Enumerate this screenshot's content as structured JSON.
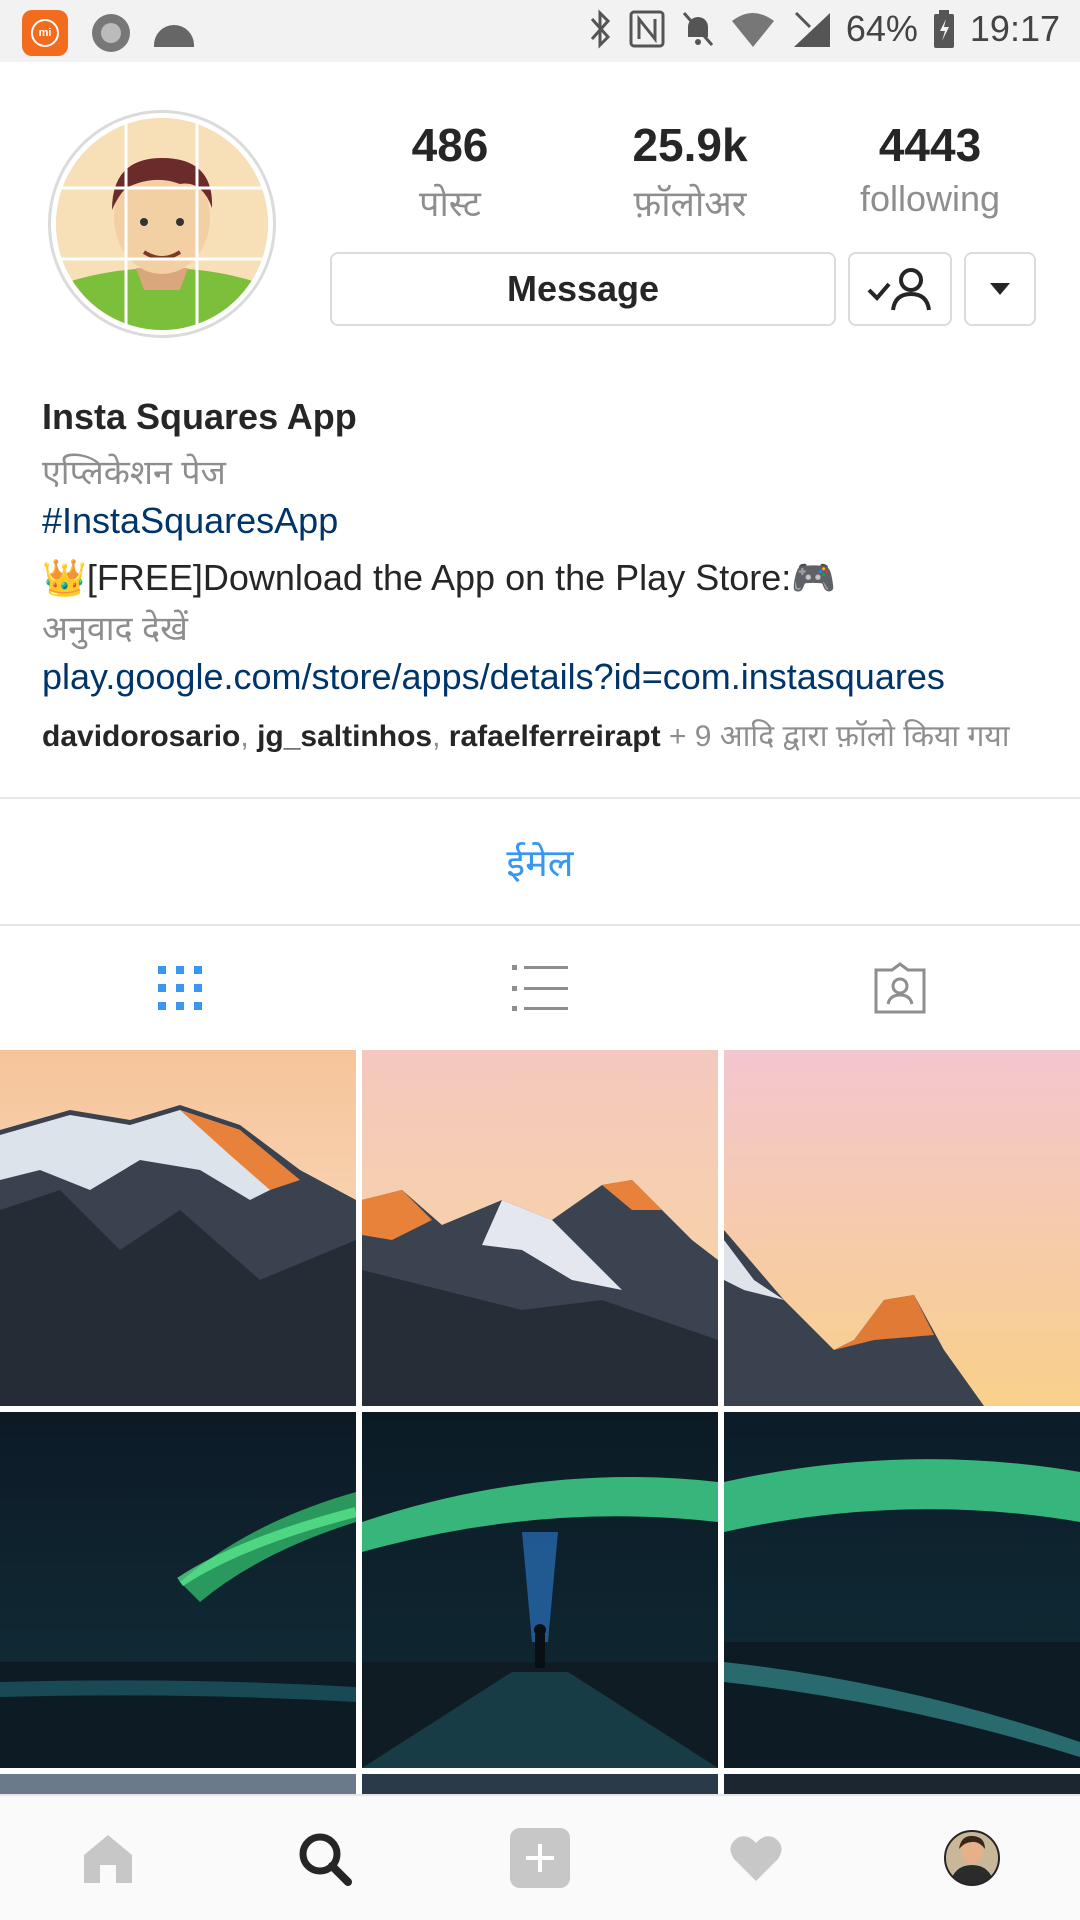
{
  "status_bar": {
    "battery": "64%",
    "time": "19:17"
  },
  "profile": {
    "posts_count": "486",
    "posts_label": "पोस्ट",
    "followers_count": "25.9k",
    "followers_label": "फ़ॉलोअर",
    "following_count": "4443",
    "following_label": "following",
    "message_label": "Message"
  },
  "bio": {
    "name": "Insta Squares App",
    "category": "एप्लिकेशन पेज",
    "hashtag": "#InstaSquaresApp",
    "crown_emoji": "👑",
    "description": "[FREE]Download the App on the Play Store: ",
    "controller_emoji": "🎮",
    "translate": "अनुवाद देखें",
    "link": "play.google.com/store/apps/details?id=com.instasquares",
    "followed_user_1": "davidorosario",
    "followed_user_2": "jg_saltinhos",
    "followed_user_3": "rafaelferreirapt",
    "followed_suffix": " + 9 आदि द्वारा फ़ॉलो किया गया"
  },
  "email_label": "ईमेल",
  "tabs": {
    "icons": [
      "grid-icon",
      "list-icon",
      "tagged-icon"
    ],
    "active": "grid"
  },
  "nav": {
    "icons": [
      "home-icon",
      "search-icon",
      "add-icon",
      "heart-icon",
      "profile-avatar"
    ],
    "active": "search"
  },
  "colors": {
    "link": "#003569",
    "accent": "#3897f0",
    "muted": "#8e8e8e"
  }
}
